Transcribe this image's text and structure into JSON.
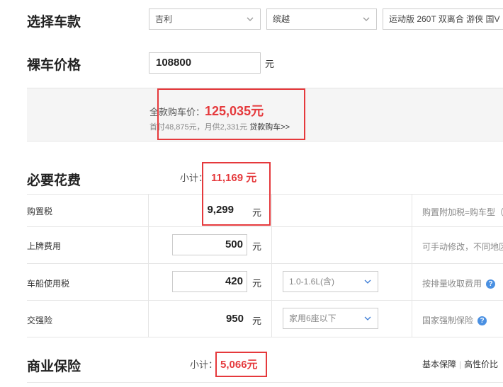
{
  "select_car": {
    "title": "选择车款",
    "brand": "吉利",
    "series": "缤越",
    "model": "运动版 260T 双离合 游侠 国V"
  },
  "bare_price": {
    "title": "裸车价格",
    "value": "108800",
    "unit": "元"
  },
  "summary": {
    "full_label": "全款购车价：",
    "full_value": "125,035元",
    "loan_text": "首付48,875元，月供2,331元",
    "loan_link": "贷款购车>>"
  },
  "required": {
    "title": "必要花费",
    "subtotal_label": "小计：",
    "subtotal_value": "11,169 元",
    "rows": [
      {
        "label": "购置税",
        "value": "9,299",
        "unit": "元",
        "note": "购置附加税=购车型（"
      },
      {
        "label": "上牌费用",
        "value": "500",
        "unit": "元",
        "note": "可手动修改，不同地区"
      },
      {
        "label": "车船使用税",
        "value": "420",
        "unit": "元",
        "option": "1.0-1.6L(含)",
        "note": "按排量收取费用"
      },
      {
        "label": "交强险",
        "value": "950",
        "unit": "元",
        "option": "家用6座以下",
        "note": "国家强制保险"
      }
    ]
  },
  "commercial": {
    "title": "商业保险",
    "subtotal_label": "小计：",
    "subtotal_value": "5,066元",
    "tab_basic": "基本保障",
    "tab_high": "高性价比"
  }
}
